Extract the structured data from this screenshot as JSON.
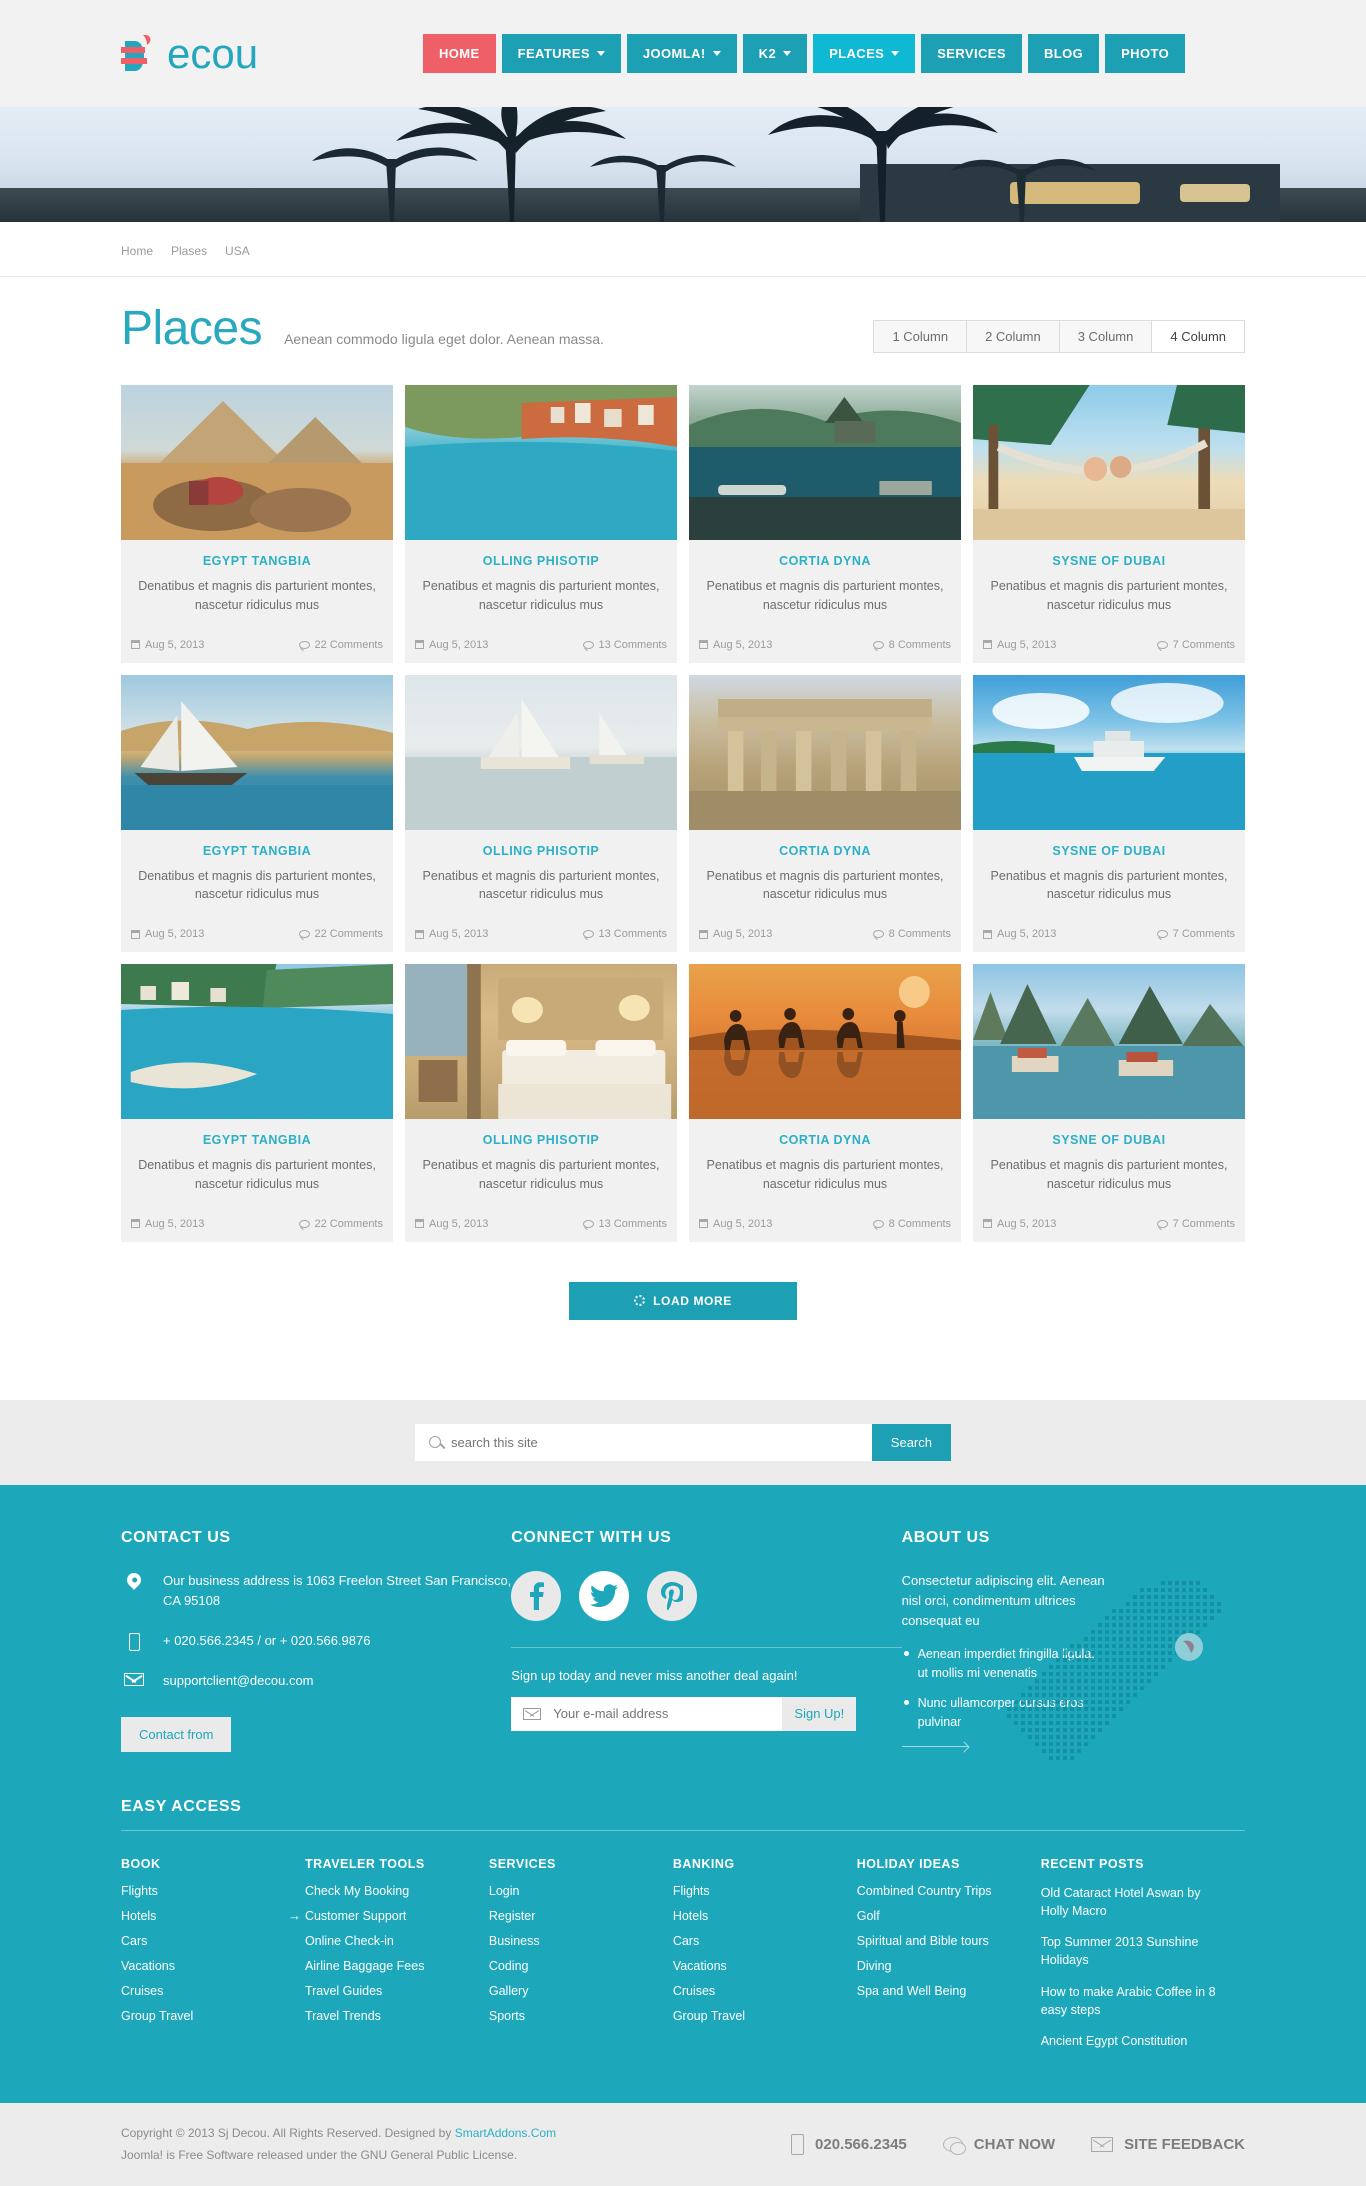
{
  "brand": {
    "name": "ecou",
    "accent": "#22a7bd",
    "red": "#ef5f68"
  },
  "nav": {
    "items": [
      {
        "label": "HOME",
        "caret": false,
        "style": "home"
      },
      {
        "label": "FEATURES",
        "caret": true,
        "style": ""
      },
      {
        "label": "JOOMLA!",
        "caret": true,
        "style": ""
      },
      {
        "label": "K2",
        "caret": true,
        "style": ""
      },
      {
        "label": "PLACES",
        "caret": true,
        "style": "places"
      },
      {
        "label": "SERVICES",
        "caret": false,
        "style": ""
      },
      {
        "label": "BLOG",
        "caret": false,
        "style": ""
      },
      {
        "label": "PHOTO",
        "caret": false,
        "style": ""
      }
    ]
  },
  "breadcrumb": {
    "items": [
      "Home",
      "Plases",
      "USA"
    ]
  },
  "page": {
    "title": "Places",
    "description": "Aenean commodo ligula eget dolor. Aenean massa.",
    "columns": [
      "1 Column",
      "2 Column",
      "3 Column",
      "4 Column"
    ],
    "active_column": "4 Column"
  },
  "cards": [
    {
      "title": "EGYPT TANGBIA",
      "text": "Denatibus et magnis dis parturient montes, nascetur ridiculus mus",
      "date": "Aug 5, 2013",
      "comments": "22 Comments",
      "theme": "pyramid"
    },
    {
      "title": "OLLING PHISOTIP",
      "text": "Penatibus et magnis dis parturient montes, nascetur ridiculus mus",
      "date": "Aug 5, 2013",
      "comments": "13 Comments",
      "theme": "coast"
    },
    {
      "title": "CORTIA DYNA",
      "text": "Penatibus et magnis dis parturient montes, nascetur ridiculus mus",
      "date": "Aug 5, 2013",
      "comments": "8 Comments",
      "theme": "pool"
    },
    {
      "title": "SYSNE OF DUBAI",
      "text": "Penatibus et magnis dis parturient montes, nascetur ridiculus mus",
      "date": "Aug 5, 2013",
      "comments": "7 Comments",
      "theme": "hammock"
    },
    {
      "title": "EGYPT TANGBIA",
      "text": "Denatibus et magnis dis parturient montes, nascetur ridiculus mus",
      "date": "Aug 5, 2013",
      "comments": "22 Comments",
      "theme": "felucca"
    },
    {
      "title": "OLLING PHISOTIP",
      "text": "Penatibus et magnis dis parturient montes, nascetur ridiculus mus",
      "date": "Aug 5, 2013",
      "comments": "13 Comments",
      "theme": "nile"
    },
    {
      "title": "CORTIA DYNA",
      "text": "Penatibus et magnis dis parturient montes, nascetur ridiculus mus",
      "date": "Aug 5, 2013",
      "comments": "8 Comments",
      "theme": "ruins"
    },
    {
      "title": "SYSNE OF DUBAI",
      "text": "Penatibus et magnis dis parturient montes, nascetur ridiculus mus",
      "date": "Aug 5, 2013",
      "comments": "7 Comments",
      "theme": "yacht"
    },
    {
      "title": "EGYPT TANGBIA",
      "text": "Denatibus et magnis dis parturient montes, nascetur ridiculus mus",
      "date": "Aug 5, 2013",
      "comments": "22 Comments",
      "theme": "bay"
    },
    {
      "title": "OLLING PHISOTIP",
      "text": "Penatibus et magnis dis parturient montes, nascetur ridiculus mus",
      "date": "Aug 5, 2013",
      "comments": "13 Comments",
      "theme": "hotelroom"
    },
    {
      "title": "CORTIA DYNA",
      "text": "Penatibus et magnis dis parturient montes, nascetur ridiculus mus",
      "date": "Aug 5, 2013",
      "comments": "8 Comments",
      "theme": "caravan"
    },
    {
      "title": "SYSNE OF DUBAI",
      "text": "Penatibus et magnis dis parturient montes, nascetur ridiculus mus",
      "date": "Aug 5, 2013",
      "comments": "7 Comments",
      "theme": "halong"
    }
  ],
  "load_more": "LOAD MORE",
  "search": {
    "placeholder": "search this site",
    "button": "Search"
  },
  "footer": {
    "contact": {
      "heading": "CONTACT US",
      "address": "Our business address is 1063 Freelon Street San Francisco, CA 95108",
      "phone": "+ 020.566.2345 / or + 020.566.9876",
      "email": "supportclient@decou.com",
      "button": "Contact from"
    },
    "connect": {
      "heading": "CONNECT WITH US",
      "socials": [
        "facebook-icon",
        "twitter-icon",
        "pinterest-icon"
      ],
      "signup_text": "Sign up today and never miss another deal again!",
      "email_placeholder": "Your e-mail address",
      "signup_button": "Sign Up!"
    },
    "about": {
      "heading": "ABOUT US",
      "text": "Consectetur adipiscing elit. Aenean nisl orci, condimentum ultrices consequat eu",
      "bullets": [
        "Aenean imperdiet fringilla ligula, ut mollis mi venenatis",
        "Nunc ullamcorper cursus eros pulvinar"
      ]
    },
    "easy_access": {
      "heading": "EASY ACCESS",
      "columns": [
        {
          "title": "BOOK",
          "links": [
            "Flights",
            "Hotels",
            "Cars",
            "Vacations",
            "Cruises",
            "Group Travel"
          ],
          "highlight": -1
        },
        {
          "title": "TRAVELER TOOLS",
          "links": [
            "Check My Booking",
            "Customer Support",
            "Online Check-in",
            "Airline Baggage Fees",
            "Travel Guides",
            "Travel Trends"
          ],
          "highlight": 1
        },
        {
          "title": "SERVICES",
          "links": [
            "Login",
            "Register",
            "Business",
            "Coding",
            "Gallery",
            "Sports"
          ],
          "highlight": -1
        },
        {
          "title": "BANKING",
          "links": [
            "Flights",
            "Hotels",
            "Cars",
            "Vacations",
            "Cruises",
            "Group Travel"
          ],
          "highlight": -1
        },
        {
          "title": "HOLIDAY IDEAS",
          "links": [
            "Combined Country Trips",
            "Golf",
            "Spiritual and Bible tours",
            "Diving",
            "Spa and Well Being"
          ],
          "highlight": -1
        },
        {
          "title": "RECENT POSTS",
          "links": [
            "Old Cataract Hotel Aswan by Holly Macro",
            "Top Summer 2013 Sunshine Holidays",
            "How to make Arabic Coffee in 8 easy steps",
            "Ancient Egypt Constitution"
          ],
          "highlight": -1
        }
      ]
    },
    "copyright": {
      "line1_pre": "Copyright © 2013 Sj Decou. All Rights Reserved. Designed by ",
      "line1_link": "SmartAddons.Com",
      "line2": "Joomla! is Free Software released under the GNU General Public License.",
      "phone": "020.566.2345",
      "chat": "CHAT NOW",
      "feedback": "SITE FEEDBACK"
    }
  }
}
